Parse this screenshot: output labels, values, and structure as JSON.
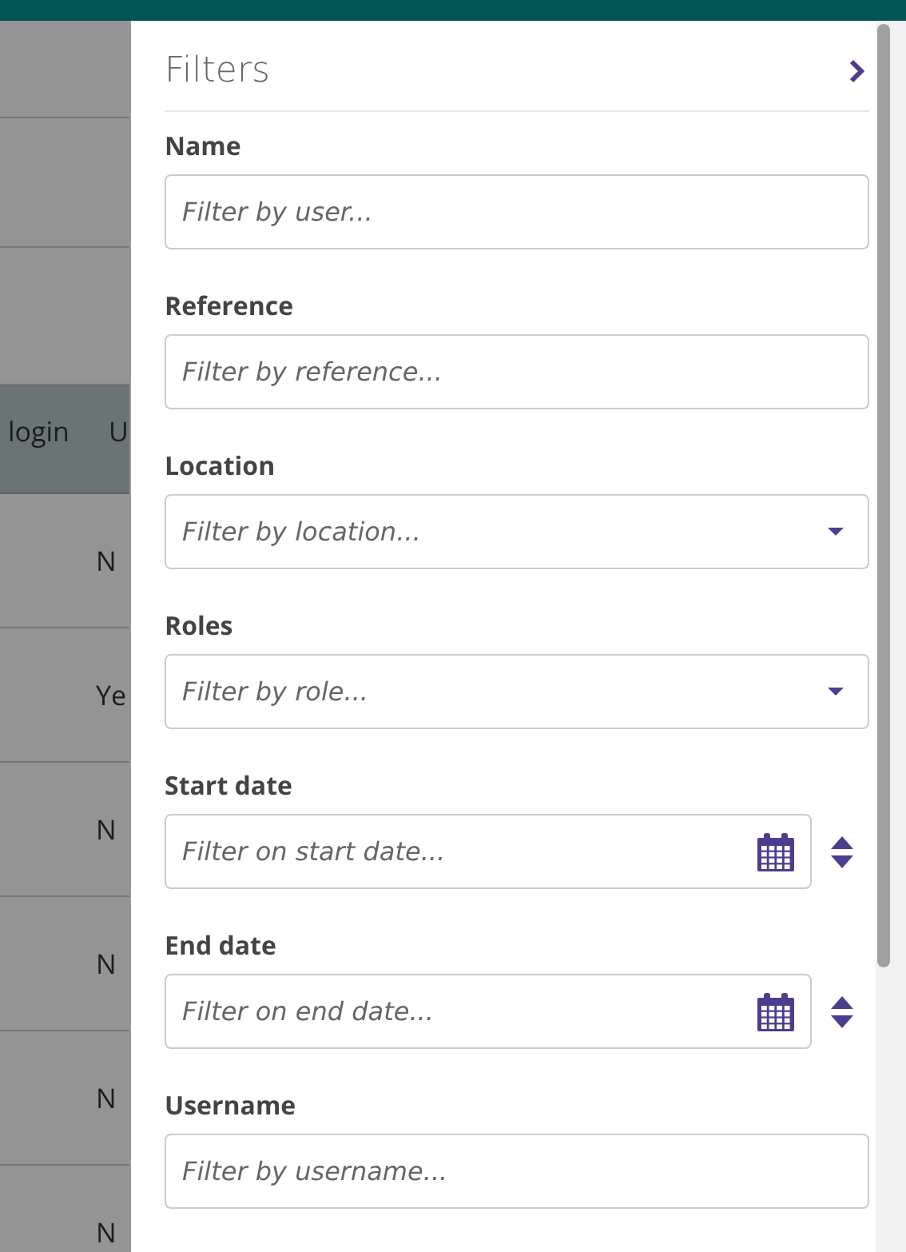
{
  "table": {
    "columns": [
      "login",
      "U"
    ],
    "rows": [
      [
        "N"
      ],
      [
        "Ye"
      ],
      [
        "N"
      ],
      [
        "N"
      ],
      [
        "N"
      ],
      [
        "N"
      ]
    ]
  },
  "filters": {
    "title": "Filters",
    "fields": [
      {
        "kind": "text",
        "label": "Name",
        "placeholder": "Filter by user..."
      },
      {
        "kind": "text",
        "label": "Reference",
        "placeholder": "Filter by reference..."
      },
      {
        "kind": "select",
        "label": "Location",
        "placeholder": "Filter by location..."
      },
      {
        "kind": "select",
        "label": "Roles",
        "placeholder": "Filter by role..."
      },
      {
        "kind": "date",
        "label": "Start date",
        "placeholder": "Filter on start date..."
      },
      {
        "kind": "date",
        "label": "End date",
        "placeholder": "Filter on end date..."
      },
      {
        "kind": "text",
        "label": "Username",
        "placeholder": "Filter by username..."
      }
    ]
  }
}
